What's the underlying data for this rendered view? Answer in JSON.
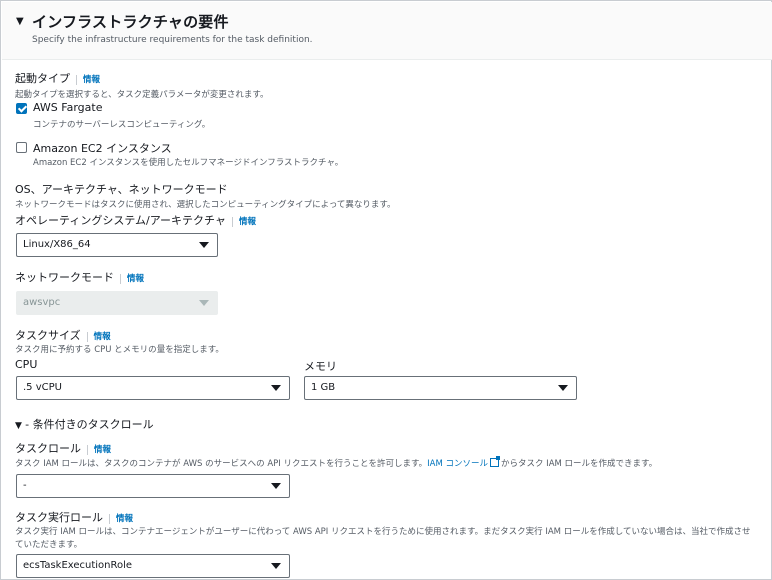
{
  "header": {
    "title": "インフラストラクチャの要件",
    "description": "Specify the infrastructure requirements for the task definition."
  },
  "info_label": "情報",
  "launch_type": {
    "label": "起動タイプ",
    "description": "起動タイプを選択すると、タスク定義パラメータが変更されます。",
    "options": [
      {
        "label": "AWS Fargate",
        "description": "コンテナのサーバーレスコンピューティング。",
        "checked": true
      },
      {
        "label": "Amazon EC2 インスタンス",
        "description": "Amazon EC2 インスタンスを使用したセルフマネージドインフラストラクチャ。",
        "checked": false
      }
    ]
  },
  "os_arch": {
    "heading": "OS、アーキテクチャ、ネットワークモード",
    "description": "ネットワークモードはタスクに使用され、選択したコンピューティングタイプによって異なります。",
    "label": "オペレーティングシステム/アーキテクチャ",
    "value": "Linux/X86_64"
  },
  "network_mode": {
    "label": "ネットワークモード",
    "value": "awsvpc"
  },
  "task_size": {
    "label": "タスクサイズ",
    "description": "タスク用に予約する CPU とメモリの量を指定します。",
    "cpu_label": "CPU",
    "cpu_value": ".5 vCPU",
    "memory_label": "メモリ",
    "memory_value": "1 GB"
  },
  "conditional_roles": {
    "heading": "- 条件付きのタスクロール"
  },
  "task_role": {
    "label": "タスクロール",
    "desc_before": "タスク IAM ロールは、タスクのコンテナが AWS のサービスへの API リクエストを行うことを許可します。",
    "desc_link": "IAM コンソール",
    "desc_after": "からタスク IAM ロールを作成できます。",
    "value": "-"
  },
  "exec_role": {
    "label": "タスク実行ロール",
    "description_line1": "タスク実行 IAM ロールは、コンテナエージェントがユーザーに代わって AWS API リクエストを行うために使用されます。まだタスク実行 IAM ロールを作成していない場合は、当社で作成させ",
    "description_line2": "ていただきます。",
    "value": "ecsTaskExecutionRole"
  },
  "colors": {
    "link": "#0073bb",
    "checkbox_checked": "#0073bb",
    "text": "#16191f",
    "secondary_text": "#545b64"
  }
}
